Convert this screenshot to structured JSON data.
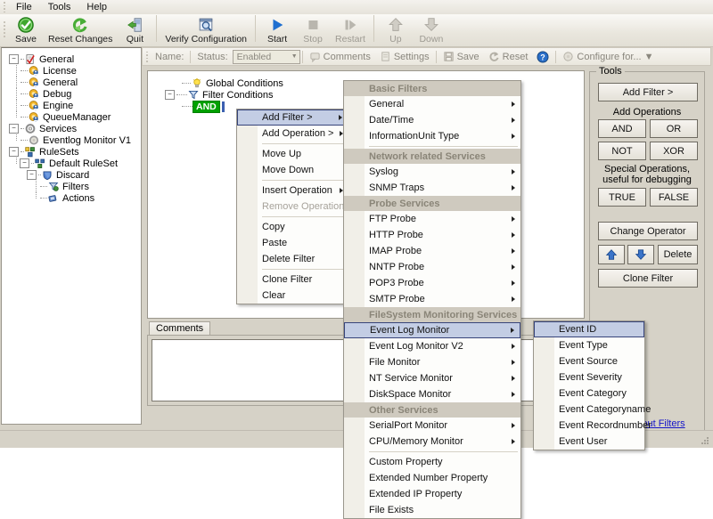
{
  "menubar": {
    "items": [
      "File",
      "Tools",
      "Help"
    ]
  },
  "toolbar": {
    "buttons": [
      {
        "label": "Save",
        "icon": "green-check-icon",
        "enabled": true
      },
      {
        "label": "Reset Changes",
        "icon": "green-refresh-icon",
        "enabled": true
      },
      {
        "label": "Quit",
        "icon": "exit-door-icon",
        "enabled": true
      },
      {
        "label": "Verify Configuration",
        "icon": "magnifier-window-icon",
        "enabled": true
      },
      {
        "label": "Start",
        "icon": "blue-play-icon",
        "enabled": true
      },
      {
        "label": "Stop",
        "icon": "grey-stop-icon",
        "enabled": false
      },
      {
        "label": "Restart",
        "icon": "grey-restart-icon",
        "enabled": false
      },
      {
        "label": "Up",
        "icon": "grey-up-arrow-icon",
        "enabled": false
      },
      {
        "label": "Down",
        "icon": "grey-down-arrow-icon",
        "enabled": false
      }
    ]
  },
  "tree": {
    "nodes": [
      {
        "label": "General",
        "depth": 0,
        "icon": "checklist-icon",
        "toggle": "-"
      },
      {
        "label": "License",
        "depth": 1,
        "icon": "gear-user-icon",
        "toggle": ""
      },
      {
        "label": "General",
        "depth": 1,
        "icon": "gear-user-icon",
        "toggle": ""
      },
      {
        "label": "Debug",
        "depth": 1,
        "icon": "gear-user-icon",
        "toggle": ""
      },
      {
        "label": "Engine",
        "depth": 1,
        "icon": "gear-user-icon",
        "toggle": ""
      },
      {
        "label": "QueueManager",
        "depth": 1,
        "icon": "gear-user-icon",
        "toggle": ""
      },
      {
        "label": "Services",
        "depth": 0,
        "icon": "services-gear-icon",
        "toggle": "-"
      },
      {
        "label": "Eventlog Monitor V1",
        "depth": 1,
        "icon": "grey-gear-icon",
        "toggle": ""
      },
      {
        "label": "RuleSets",
        "depth": 0,
        "icon": "rulesets-icon",
        "toggle": "-"
      },
      {
        "label": "Default RuleSet",
        "depth": 1,
        "icon": "ruleset-icon",
        "toggle": "-"
      },
      {
        "label": "Discard",
        "depth": 2,
        "icon": "shield-icon",
        "toggle": "-"
      },
      {
        "label": "Filters",
        "depth": 3,
        "icon": "funnel-icon",
        "toggle": ""
      },
      {
        "label": "Actions",
        "depth": 3,
        "icon": "action-icon",
        "toggle": ""
      }
    ]
  },
  "propbar": {
    "name_label": "Name:",
    "status_label": "Status:",
    "status_value": "Enabled",
    "comments": "Comments",
    "settings": "Settings",
    "save": "Save",
    "reset": "Reset",
    "help_icon": "blue-question-icon",
    "configure_for": "Configure for..."
  },
  "filtertree": {
    "rows": [
      {
        "label": "Global Conditions",
        "icon": "lightbulb-icon",
        "toggle": ""
      },
      {
        "label": "Filter Conditions",
        "icon": "funnel-icon",
        "toggle": "-"
      },
      {
        "label": "AND",
        "icon": "",
        "toggle": "",
        "badge": true
      }
    ]
  },
  "comments": {
    "tab_label": "Comments",
    "value": ""
  },
  "tools": {
    "title": "Tools",
    "add_filter": "Add Filter >",
    "add_operations_label": "Add Operations",
    "and": "AND",
    "or": "OR",
    "not": "NOT",
    "xor": "XOR",
    "special_label_line1": "Special Operations,",
    "special_label_line2": "useful for debugging",
    "true": "TRUE",
    "false": "FALSE",
    "change_operator": "Change Operator",
    "move_up_icon": "blue-up-arrow-icon",
    "move_down_icon": "blue-down-arrow-icon",
    "delete": "Delete",
    "clone_filter": "Clone Filter",
    "help_link": "More about Filters"
  },
  "context_menu": {
    "items": [
      {
        "label": "Add Filter >",
        "submenu": true,
        "selected": true
      },
      {
        "label": "Add Operation >",
        "submenu": true
      },
      {
        "sep": true
      },
      {
        "label": "Move Up"
      },
      {
        "label": "Move Down"
      },
      {
        "sep": true
      },
      {
        "label": "Insert Operation",
        "submenu": true
      },
      {
        "label": "Remove Operation",
        "disabled": true
      },
      {
        "sep": true
      },
      {
        "label": "Copy"
      },
      {
        "label": "Paste"
      },
      {
        "label": "Delete Filter"
      },
      {
        "sep": true
      },
      {
        "label": "Clone Filter"
      },
      {
        "label": "Clear"
      }
    ]
  },
  "filter_submenu": {
    "items": [
      {
        "header": "Basic Filters"
      },
      {
        "label": "General",
        "submenu": true
      },
      {
        "label": "Date/Time",
        "submenu": true
      },
      {
        "label": "InformationUnit Type",
        "submenu": true
      },
      {
        "sep": true
      },
      {
        "header": "Network related Services"
      },
      {
        "label": "Syslog",
        "submenu": true
      },
      {
        "label": "SNMP Traps",
        "submenu": true
      },
      {
        "header": "Probe Services"
      },
      {
        "label": "FTP Probe",
        "submenu": true
      },
      {
        "label": "HTTP Probe",
        "submenu": true
      },
      {
        "label": "IMAP Probe",
        "submenu": true
      },
      {
        "label": "NNTP Probe",
        "submenu": true
      },
      {
        "label": "POP3 Probe",
        "submenu": true
      },
      {
        "label": "SMTP Probe",
        "submenu": true
      },
      {
        "header": "FileSystem Monitoring Services"
      },
      {
        "label": "Event Log Monitor",
        "submenu": true,
        "selected": true
      },
      {
        "label": "Event Log Monitor V2",
        "submenu": true
      },
      {
        "label": "File Monitor",
        "submenu": true
      },
      {
        "label": "NT Service Monitor",
        "submenu": true
      },
      {
        "label": "DiskSpace Monitor",
        "submenu": true
      },
      {
        "header": "Other Services"
      },
      {
        "label": "SerialPort Monitor",
        "submenu": true
      },
      {
        "label": "CPU/Memory Monitor",
        "submenu": true
      },
      {
        "sep": true
      },
      {
        "label": "Custom Property"
      },
      {
        "label": "Extended Number Property"
      },
      {
        "label": "Extended IP Property"
      },
      {
        "label": "File Exists"
      }
    ]
  },
  "eventlog_submenu": {
    "items": [
      {
        "label": "Event ID",
        "selected": true
      },
      {
        "label": "Event Type"
      },
      {
        "label": "Event Source"
      },
      {
        "label": "Event Severity"
      },
      {
        "label": "Event Category"
      },
      {
        "label": "Event Categoryname"
      },
      {
        "label": "Event Recordnumber"
      },
      {
        "label": "Event User"
      }
    ]
  },
  "colors": {
    "window_bg": "#d6d2c7",
    "accent_selection": "#c3cde4",
    "and_badge": "#00a000",
    "link": "#1414c8"
  }
}
